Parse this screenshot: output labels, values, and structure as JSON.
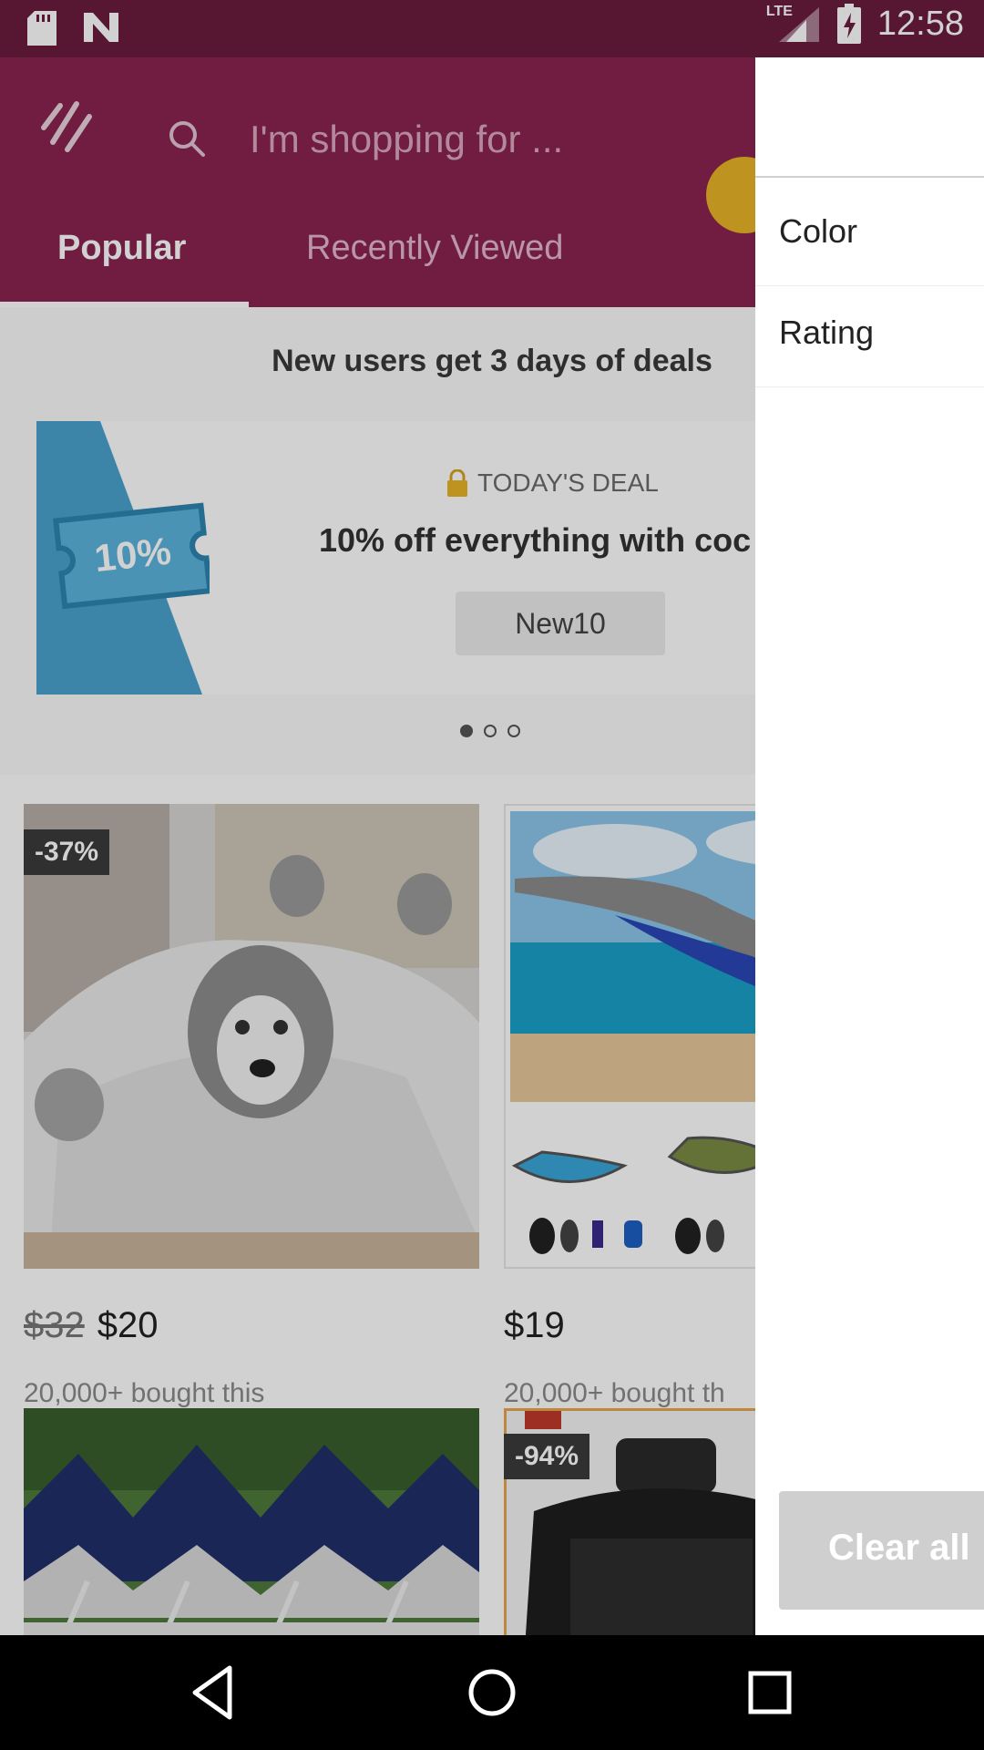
{
  "status_bar": {
    "time": "12:58",
    "network": "LTE",
    "icons": [
      "sd-card-icon",
      "n-notification-icon",
      "signal-icon",
      "battery-charging-icon"
    ]
  },
  "header": {
    "logo": "wish-logo-icon",
    "search_placeholder": "I'm shopping for ...",
    "tabs": [
      {
        "label": "Popular",
        "active": true
      },
      {
        "label": "Recently Viewed",
        "active": false
      }
    ]
  },
  "banner": {
    "heading": "New users get 3 days of deals",
    "coupon_text": "10%",
    "deal_label": "TODAY'S DEAL",
    "deal_title": "10% off everything with coc",
    "code": "New10",
    "page_index": 0,
    "page_count": 3
  },
  "products": [
    {
      "discount": "-37%",
      "old_price": "$32",
      "price": "$20",
      "sold": "20,000+ bought this"
    },
    {
      "discount": "",
      "old_price": "",
      "price": "$19",
      "sold": "20,000+ bought th"
    },
    {
      "discount": "",
      "old_price": "",
      "price": "",
      "sold": ""
    },
    {
      "discount": "-94%",
      "old_price": "",
      "price": "",
      "sold": ""
    }
  ],
  "filter_drawer": {
    "items": [
      {
        "label": "Color"
      },
      {
        "label": "Rating"
      }
    ],
    "clear_label": "Clear all"
  },
  "colors": {
    "brand": "#8a2350",
    "status_bar": "#6b1c3e",
    "coupon_blue": "#4aa3cf"
  }
}
